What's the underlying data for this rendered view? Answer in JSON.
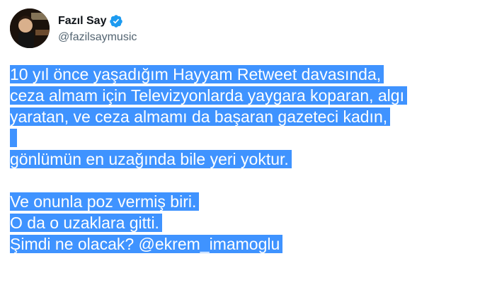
{
  "user": {
    "display_name": "Fazıl Say",
    "handle": "@fazilsaymusic",
    "verified": true,
    "avatar_icon": "profile-photo"
  },
  "tweet": {
    "lines": [
      "10 yıl önce yaşadığım Hayyam Retweet davasında,",
      "ceza almam için Televizyonlarda yaygara koparan, algı",
      "yaratan, ve ceza almamı da başaran gazeteci kadın,",
      "",
      "gönlümün en uzağında bile yeri yoktur.",
      "",
      "Ve onunla poz vermiş biri.",
      "O da o uzaklara gitti.",
      "Şimdi ne olacak?"
    ],
    "mention": "@ekrem_imamoglu"
  },
  "colors": {
    "selection": "#3f93ff",
    "verified_badge": "#1d9bf0",
    "handle_text": "#536471"
  }
}
